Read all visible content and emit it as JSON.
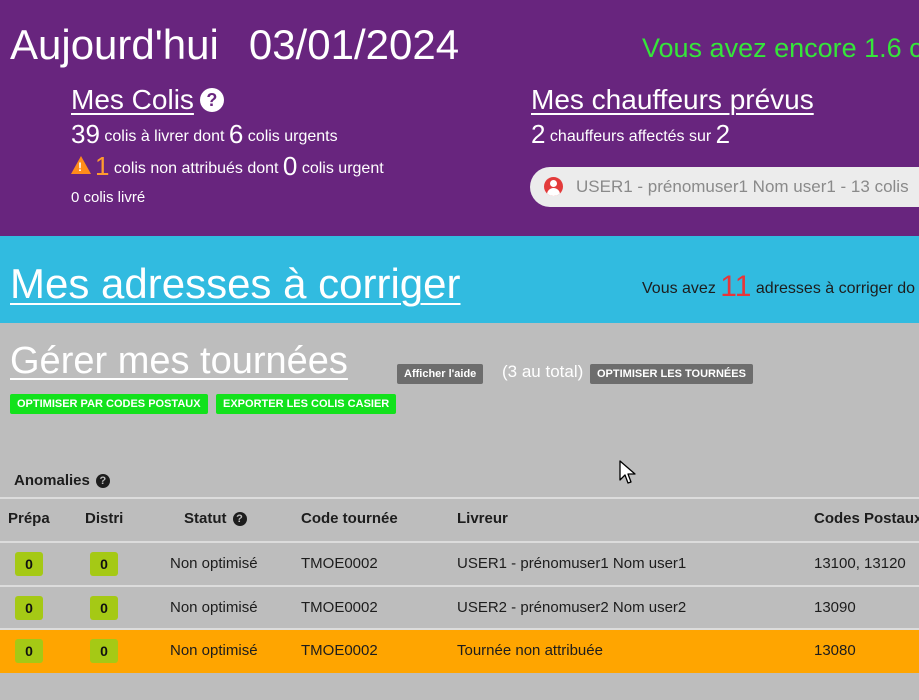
{
  "header": {
    "today_label": "Aujourd'hui",
    "date": "03/01/2024",
    "remaining_text": "Vous avez encore 1.6 c"
  },
  "colis": {
    "title": "Mes Colis",
    "a_livrer": "39",
    "a_livrer_text": "colis à livrer dont",
    "urgents": "6",
    "urgents_text": "colis urgents",
    "non_attribues": "1",
    "non_attribues_text": "colis non attribués dont",
    "urgent_count": "0",
    "urgent_text": "colis urgent",
    "livre_text": "0 colis livré"
  },
  "chauffeurs": {
    "title": "Mes chauffeurs prévus",
    "affectes": "2",
    "text": "chauffeurs affectés sur",
    "total": "2",
    "driver_pill": "USER1 - prénomuser1 Nom user1 - 13 colis"
  },
  "adresses": {
    "title": "Mes adresses à corriger",
    "prefix": "Vous avez",
    "count": "11",
    "suffix": "adresses à corriger do"
  },
  "tournees": {
    "title": "Gérer mes tournées",
    "help_button": "Afficher l'aide",
    "total": "(3 au total)",
    "optimize_button": "OPTIMISER LES TOURNÉES",
    "optimize_cp_button": "OPTIMISER PAR CODES POSTAUX",
    "export_button": "EXPORTER LES COLIS CASIER",
    "anomalies_label": "Anomalies"
  },
  "table": {
    "headers": {
      "prepa": "Prépa",
      "distri": "Distri",
      "statut": "Statut",
      "code": "Code tournée",
      "livreur": "Livreur",
      "codes_postaux": "Codes Postaux"
    },
    "rows": [
      {
        "prepa": "0",
        "distri": "0",
        "statut": "Non optimisé",
        "code": "TMOE0002",
        "livreur": "USER1 - prénomuser1 Nom user1",
        "cp": "13100, 13120"
      },
      {
        "prepa": "0",
        "distri": "0",
        "statut": "Non optimisé",
        "code": "TMOE0002",
        "livreur": "USER2 - prénomuser2 Nom user2",
        "cp": "13090"
      },
      {
        "prepa": "0",
        "distri": "0",
        "statut": "Non optimisé",
        "code": "TMOE0002",
        "livreur": "Tournée non attribuée",
        "cp": "13080"
      }
    ]
  },
  "colors": {
    "header_bg": "#68257e",
    "addr_bg": "#31bbe0",
    "main_bg": "#bdbdbd",
    "highlight_row": "#ffa500",
    "badge": "#a5c915",
    "green_button": "#12e21c"
  }
}
